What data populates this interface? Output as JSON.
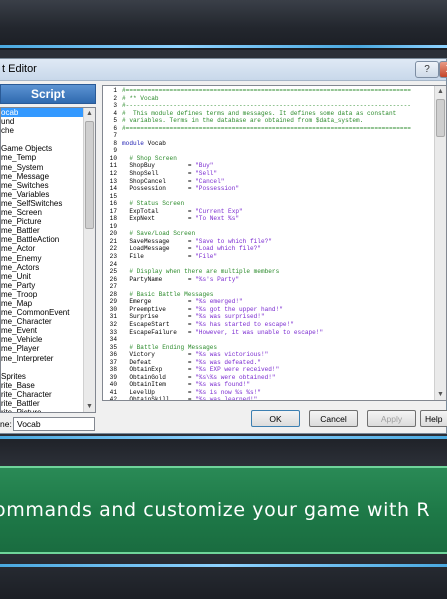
{
  "window": {
    "title": "t Editor",
    "help_button": "?",
    "close_button": "X"
  },
  "left_panel": {
    "header": "Script",
    "items": [
      "ocab",
      "und",
      "che",
      "",
      "Game Objects",
      "me_Temp",
      "me_System",
      "me_Message",
      "me_Switches",
      "me_Variables",
      "me_SelfSwitches",
      "me_Screen",
      "me_Picture",
      "me_Battler",
      "me_BattleAction",
      "me_Actor",
      "me_Enemy",
      "me_Actors",
      "me_Unit",
      "me_Party",
      "me_Troop",
      "me_Map",
      "me_CommonEvent",
      "me_Character",
      "me_Event",
      "me_Vehicle",
      "me_Player",
      "me_Interpreter",
      "",
      "Sprites",
      "rite_Base",
      "rite_Character",
      "rite_Battler",
      "rite_Picture",
      "rite_Timer",
      "riteset_Weather",
      "riteset_Map"
    ],
    "selected_index": 0,
    "name_label": "ne:",
    "name_value": "Vocab"
  },
  "code": {
    "lines": [
      {
        "n": "1",
        "parts": [
          {
            "t": "#==============================================================================",
            "c": "comment"
          }
        ]
      },
      {
        "n": "2",
        "parts": [
          {
            "t": "# ** Vocab",
            "c": "comment"
          }
        ]
      },
      {
        "n": "3",
        "parts": [
          {
            "t": "#------------------------------------------------------------------------------",
            "c": "comment"
          }
        ]
      },
      {
        "n": "4",
        "parts": [
          {
            "t": "#  This module defines terms and messages. It defines some data as constant",
            "c": "comment"
          }
        ]
      },
      {
        "n": "5",
        "parts": [
          {
            "t": "# variables. Terms in the database are obtained from $data_system.",
            "c": "comment"
          }
        ]
      },
      {
        "n": "6",
        "parts": [
          {
            "t": "#==============================================================================",
            "c": "comment"
          }
        ]
      },
      {
        "n": "7",
        "parts": []
      },
      {
        "n": "8",
        "parts": [
          {
            "t": "module",
            "c": "keyword"
          },
          {
            "t": " Vocab",
            "c": ""
          }
        ]
      },
      {
        "n": "9",
        "parts": []
      },
      {
        "n": "10",
        "parts": [
          {
            "t": "  # Shop Screen",
            "c": "comment"
          }
        ]
      },
      {
        "n": "11",
        "parts": [
          {
            "t": "  ShopBuy         = ",
            "c": ""
          },
          {
            "t": "\"Buy\"",
            "c": "string"
          }
        ]
      },
      {
        "n": "12",
        "parts": [
          {
            "t": "  ShopSell        = ",
            "c": ""
          },
          {
            "t": "\"Sell\"",
            "c": "string"
          }
        ]
      },
      {
        "n": "13",
        "parts": [
          {
            "t": "  ShopCancel      = ",
            "c": ""
          },
          {
            "t": "\"Cancel\"",
            "c": "string"
          }
        ]
      },
      {
        "n": "14",
        "parts": [
          {
            "t": "  Possession      = ",
            "c": ""
          },
          {
            "t": "\"Possession\"",
            "c": "string"
          }
        ]
      },
      {
        "n": "15",
        "parts": []
      },
      {
        "n": "16",
        "parts": [
          {
            "t": "  # Status Screen",
            "c": "comment"
          }
        ]
      },
      {
        "n": "17",
        "parts": [
          {
            "t": "  ExpTotal        = ",
            "c": ""
          },
          {
            "t": "\"Current Exp\"",
            "c": "string"
          }
        ]
      },
      {
        "n": "18",
        "parts": [
          {
            "t": "  ExpNext         = ",
            "c": ""
          },
          {
            "t": "\"To Next %s\"",
            "c": "string"
          }
        ]
      },
      {
        "n": "19",
        "parts": []
      },
      {
        "n": "20",
        "parts": [
          {
            "t": "  # Save/Load Screen",
            "c": "comment"
          }
        ]
      },
      {
        "n": "21",
        "parts": [
          {
            "t": "  SaveMessage     = ",
            "c": ""
          },
          {
            "t": "\"Save to which file?\"",
            "c": "string"
          }
        ]
      },
      {
        "n": "22",
        "parts": [
          {
            "t": "  LoadMessage     = ",
            "c": ""
          },
          {
            "t": "\"Load which file?\"",
            "c": "string"
          }
        ]
      },
      {
        "n": "23",
        "parts": [
          {
            "t": "  File            = ",
            "c": ""
          },
          {
            "t": "\"File\"",
            "c": "string"
          }
        ]
      },
      {
        "n": "24",
        "parts": []
      },
      {
        "n": "25",
        "parts": [
          {
            "t": "  # Display when there are multiple members",
            "c": "comment"
          }
        ]
      },
      {
        "n": "26",
        "parts": [
          {
            "t": "  PartyName       = ",
            "c": ""
          },
          {
            "t": "\"%s's Party\"",
            "c": "string"
          }
        ]
      },
      {
        "n": "27",
        "parts": []
      },
      {
        "n": "28",
        "parts": [
          {
            "t": "  # Basic Battle Messages",
            "c": "comment"
          }
        ]
      },
      {
        "n": "29",
        "parts": [
          {
            "t": "  Emerge          = ",
            "c": ""
          },
          {
            "t": "\"%s emerged!\"",
            "c": "string"
          }
        ]
      },
      {
        "n": "30",
        "parts": [
          {
            "t": "  Preemptive      = ",
            "c": ""
          },
          {
            "t": "\"%s got the upper hand!\"",
            "c": "string"
          }
        ]
      },
      {
        "n": "31",
        "parts": [
          {
            "t": "  Surprise        = ",
            "c": ""
          },
          {
            "t": "\"%s was surprised!\"",
            "c": "string"
          }
        ]
      },
      {
        "n": "32",
        "parts": [
          {
            "t": "  EscapeStart     = ",
            "c": ""
          },
          {
            "t": "\"%s has started to escape!\"",
            "c": "string"
          }
        ]
      },
      {
        "n": "33",
        "parts": [
          {
            "t": "  EscapeFailure   = ",
            "c": ""
          },
          {
            "t": "\"However, it was unable to escape!\"",
            "c": "string"
          }
        ]
      },
      {
        "n": "34",
        "parts": []
      },
      {
        "n": "35",
        "parts": [
          {
            "t": "  # Battle Ending Messages",
            "c": "comment"
          }
        ]
      },
      {
        "n": "36",
        "parts": [
          {
            "t": "  Victory         = ",
            "c": ""
          },
          {
            "t": "\"%s was victorious!\"",
            "c": "string"
          }
        ]
      },
      {
        "n": "37",
        "parts": [
          {
            "t": "  Defeat          = ",
            "c": ""
          },
          {
            "t": "\"%s was defeated.\"",
            "c": "string"
          }
        ]
      },
      {
        "n": "38",
        "parts": [
          {
            "t": "  ObtainExp       = ",
            "c": ""
          },
          {
            "t": "\"%s EXP were received!\"",
            "c": "string"
          }
        ]
      },
      {
        "n": "39",
        "parts": [
          {
            "t": "  ObtainGold      = ",
            "c": ""
          },
          {
            "t": "\"%s\\%s were obtained!\"",
            "c": "string"
          }
        ]
      },
      {
        "n": "40",
        "parts": [
          {
            "t": "  ObtainItem      = ",
            "c": ""
          },
          {
            "t": "\"%s was found!\"",
            "c": "string"
          }
        ]
      },
      {
        "n": "41",
        "parts": [
          {
            "t": "  LevelUp         = ",
            "c": ""
          },
          {
            "t": "\"%s is now %s %s!\"",
            "c": "string"
          }
        ]
      },
      {
        "n": "42",
        "parts": [
          {
            "t": "  ObtainSkill     = ",
            "c": ""
          },
          {
            "t": "\"%s was learned!\"",
            "c": "string"
          }
        ]
      }
    ]
  },
  "buttons": {
    "ok": "OK",
    "cancel": "Cancel",
    "apply": "Apply",
    "help": "Help"
  },
  "banner": {
    "text": "ommands and customize your game with R"
  },
  "colors": {
    "comment": "#2a8a2a",
    "string": "#7a2ad0",
    "keyword": "#1a1ab0",
    "selection": "#3399ff",
    "banner": "#1e7a48"
  }
}
